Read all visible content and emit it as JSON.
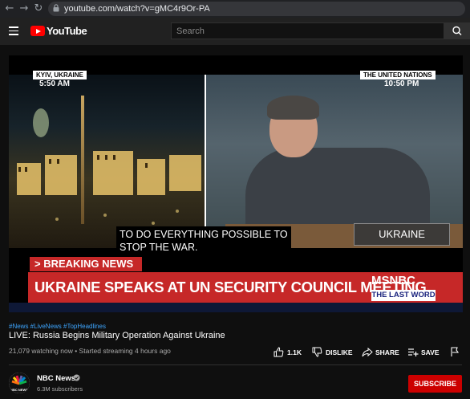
{
  "browser": {
    "url": "youtube.com/watch?v=gMC4r9Or-PA",
    "icons": [
      "back-icon",
      "forward-icon",
      "reload-icon",
      "lock-icon"
    ]
  },
  "header": {
    "logo_text": "YouTube",
    "search_placeholder": "Search"
  },
  "video": {
    "left_location": "KYIV, UKRAINE",
    "left_time": "5:50 AM",
    "right_location": "THE UNITED NATIONS",
    "right_time": "10:50 PM",
    "nameplate": "UKRAINE",
    "caption": "TO DO EVERYTHING POSSIBLE TO\nSTOP THE WAR.",
    "breaking_label": "> BREAKING NEWS",
    "headline": "UKRAINE SPEAKS AT UN SECURITY COUNCIL MEETING",
    "network": "MSNBC",
    "show": "THE LAST WORD",
    "colors": {
      "breaking_red": "#c62828"
    }
  },
  "info": {
    "hashtags": "#News #LiveNews #TopHeadlines",
    "title": "LIVE: Russia Begins Military Operation Against Ukraine",
    "meta": "21,079 watching now • Started streaming 4 hours ago",
    "actions": {
      "like": "1.1K",
      "dislike": "DISLIKE",
      "share": "SHARE",
      "save": "SAVE"
    }
  },
  "channel": {
    "name": "NBC News",
    "subscribers": "6.3M subscribers",
    "avatar_text": "NBC NEWS",
    "subscribe_label": "SUBSCRIBE"
  }
}
